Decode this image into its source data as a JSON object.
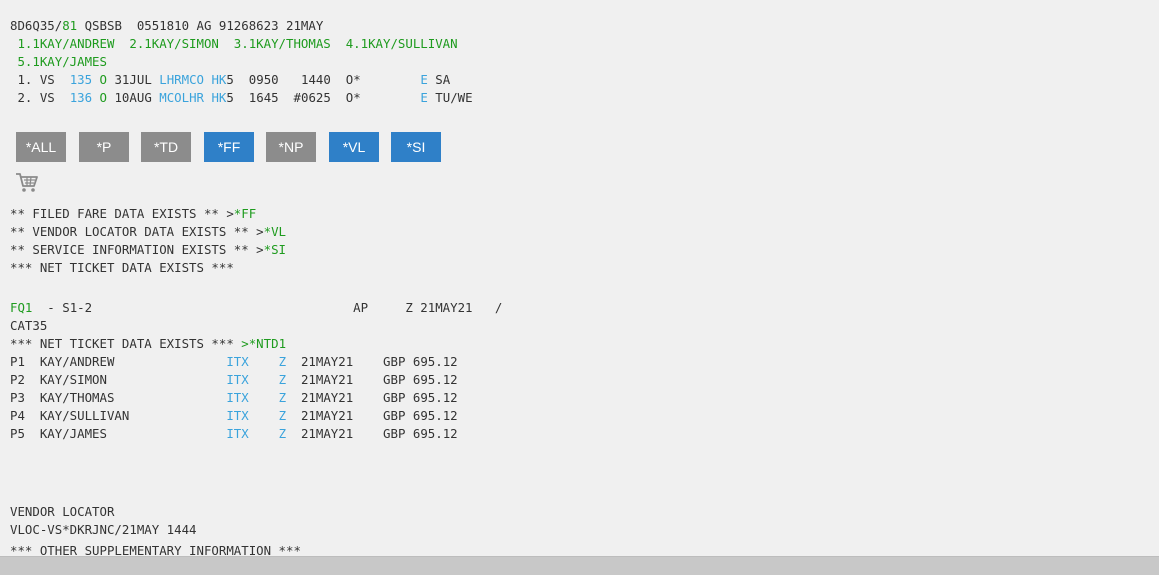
{
  "pnr": {
    "header": {
      "a": "8D6Q35/",
      "b": "81",
      "c": " QSBSB  0551810 AG 91268623 21MAY"
    },
    "names_line1": " 1.1KAY/ANDREW  2.1KAY/SIMON  3.1KAY/THOMAS  4.1KAY/SULLIVAN",
    "names_line2": " 5.1KAY/JAMES",
    "segments": [
      {
        "num": " 1. VS  ",
        "flight": "135",
        "cls": "O",
        "date": " 31JUL ",
        "city": "LHRMCO",
        "status": "HK",
        "rest": "5  0950   1440  O*        ",
        "e": "E",
        "days": " SA"
      },
      {
        "num": " 2. VS  ",
        "flight": "136",
        "cls": "O",
        "date": " 10AUG ",
        "city": "MCOLHR",
        "status": "HK",
        "rest": "5  1645  #0625  O*        ",
        "e": "E",
        "days": " TU/WE"
      }
    ]
  },
  "buttons": [
    {
      "label": "*ALL",
      "color": "#8c8c8c"
    },
    {
      "label": "*P",
      "color": "#8c8c8c"
    },
    {
      "label": "*TD",
      "color": "#8c8c8c"
    },
    {
      "label": "*FF",
      "color": "#2f80c8"
    },
    {
      "label": "*NP",
      "color": "#8c8c8c"
    },
    {
      "label": "*VL",
      "color": "#2f80c8"
    },
    {
      "label": "*SI",
      "color": "#2f80c8"
    }
  ],
  "icons": {
    "cart": "shopping-cart-icon"
  },
  "notices": [
    {
      "text": "** FILED FARE DATA EXISTS ** >",
      "link": "*FF"
    },
    {
      "text": "** VENDOR LOCATOR DATA EXISTS ** >",
      "link": "*VL"
    },
    {
      "text": "** SERVICE INFORMATION EXISTS ** >",
      "link": "*SI"
    },
    {
      "text": "*** NET TICKET DATA EXISTS ***",
      "link": ""
    }
  ],
  "fare": {
    "fq_label": "FQ1",
    "fq_rest": "  - S1-2                                   AP     Z 21MAY21   /",
    "cat": "CAT35",
    "net_text": "*** NET TICKET DATA EXISTS *** ",
    "net_link": ">*NTD1",
    "passengers": [
      {
        "p": "P1  KAY/ANDREW               ",
        "type": "ITX",
        "code": "Z",
        "date": "  21MAY21    GBP 695.12"
      },
      {
        "p": "P2  KAY/SIMON                ",
        "type": "ITX",
        "code": "Z",
        "date": "  21MAY21    GBP 695.12"
      },
      {
        "p": "P3  KAY/THOMAS               ",
        "type": "ITX",
        "code": "Z",
        "date": "  21MAY21    GBP 695.12"
      },
      {
        "p": "P4  KAY/SULLIVAN             ",
        "type": "ITX",
        "code": "Z",
        "date": "  21MAY21    GBP 695.12"
      },
      {
        "p": "P5  KAY/JAMES                ",
        "type": "ITX",
        "code": "Z",
        "date": "  21MAY21    GBP 695.12"
      }
    ]
  },
  "vendor": {
    "title": "VENDOR LOCATOR",
    "vloc": "VLOC-VS*DKRJNC/21MAY 1444",
    "other": "*** OTHER SUPPLEMENTARY INFORMATION ***"
  }
}
